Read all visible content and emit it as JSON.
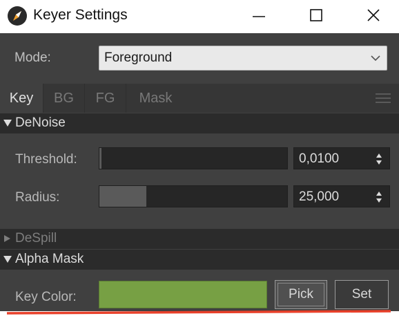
{
  "window": {
    "title": "Keyer Settings",
    "icon": "compass-icon",
    "controls": [
      "minimize-icon",
      "maximize-icon",
      "close-icon"
    ]
  },
  "mode": {
    "label": "Mode:",
    "value": "Foreground"
  },
  "tabs": [
    {
      "label": "Key",
      "active": true
    },
    {
      "label": "BG",
      "active": false
    },
    {
      "label": "FG",
      "active": false
    },
    {
      "label": "Mask",
      "active": false
    }
  ],
  "sections": {
    "denoise": {
      "label": "DeNoise",
      "expanded": true,
      "threshold": {
        "label": "Threshold:",
        "value": "0,0100",
        "fill_fraction": 0.01
      },
      "radius": {
        "label": "Radius:",
        "value": "25,000",
        "fill_fraction": 0.25
      }
    },
    "despill": {
      "label": "DeSpill",
      "expanded": false
    },
    "alpha_mask": {
      "label": "Alpha Mask",
      "expanded": true,
      "key_color": {
        "label": "Key Color:",
        "color": "#77a044"
      },
      "pick_label": "Pick",
      "set_label": "Set"
    }
  },
  "colors": {
    "panel_bg": "#404040",
    "section_header_bg": "#2b2b2b",
    "annotation_underline": "#e8402a"
  }
}
